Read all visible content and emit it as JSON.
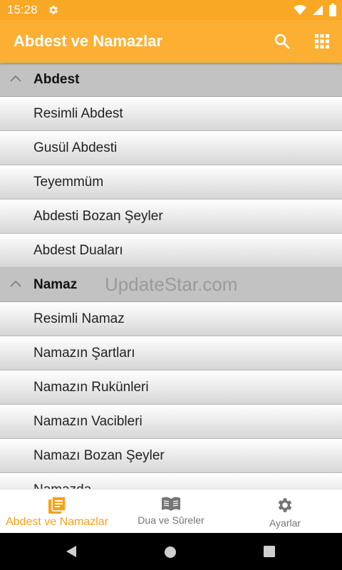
{
  "status_bar": {
    "time": "15:28",
    "icons": [
      "settings-icon",
      "wifi-icon",
      "signal-icon",
      "battery-icon"
    ]
  },
  "app_bar": {
    "title": "Abdest ve Namazlar",
    "actions": [
      "search-icon",
      "grid-menu-icon"
    ]
  },
  "sections": [
    {
      "title": "Abdest",
      "items": [
        "Resimli Abdest",
        "Gusül Abdesti",
        "Teyemmüm",
        "Abdesti Bozan Şeyler",
        "Abdest Duaları"
      ]
    },
    {
      "title": "Namaz",
      "items": [
        "Resimli Namaz",
        "Namazın Şartları",
        "Namazın Rukünleri",
        "Namazın Vacibleri",
        "Namazı Bozan Şeyler",
        "Namazda ..."
      ]
    }
  ],
  "watermark": "UpdateStar.com",
  "bottom_nav": [
    {
      "label": "Abdest ve Namazlar",
      "icon": "notes-list-icon",
      "active": true
    },
    {
      "label": "Dua ve Sûreler",
      "icon": "open-book-icon",
      "active": false
    },
    {
      "label": "Ayarlar",
      "icon": "gear-icon",
      "active": false
    }
  ],
  "colors": {
    "accent": "#fbb034",
    "status_bar": "#f9a825",
    "active_tab": "#f6a21c",
    "section_header": "#c2c2c2"
  }
}
